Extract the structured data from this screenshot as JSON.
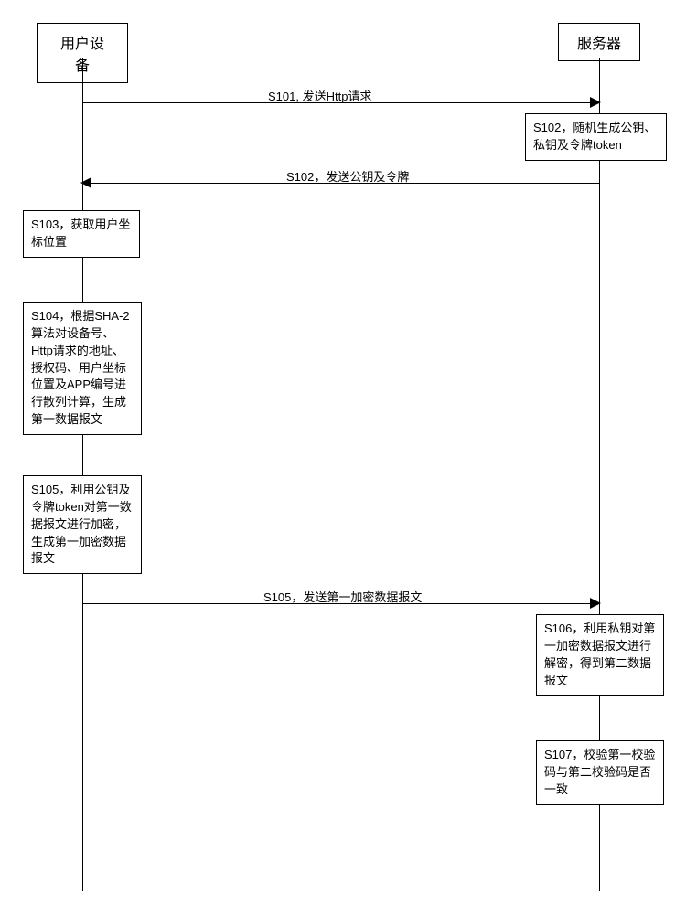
{
  "actors": {
    "user_device": "用户设备",
    "server": "服务器"
  },
  "messages": {
    "m1": "S101, 发送Http请求",
    "m2": "S102，发送公钥及令牌",
    "m3": "S105，发送第一加密数据报文"
  },
  "steps": {
    "s102": "S102，随机生成公钥、私钥及令牌token",
    "s103": "S103，获取用户坐标位置",
    "s104": "S104，根据SHA-2算法对设备号、Http请求的地址、授权码、用户坐标位置及APP编号进行散列计算，生成第一数据报文",
    "s105": "S105，利用公钥及令牌token对第一数据报文进行加密，生成第一加密数据报文",
    "s106": "S106，利用私钥对第一加密数据报文进行解密，得到第二数据报文",
    "s107": "S107，校验第一校验码与第二校验码是否一致"
  }
}
